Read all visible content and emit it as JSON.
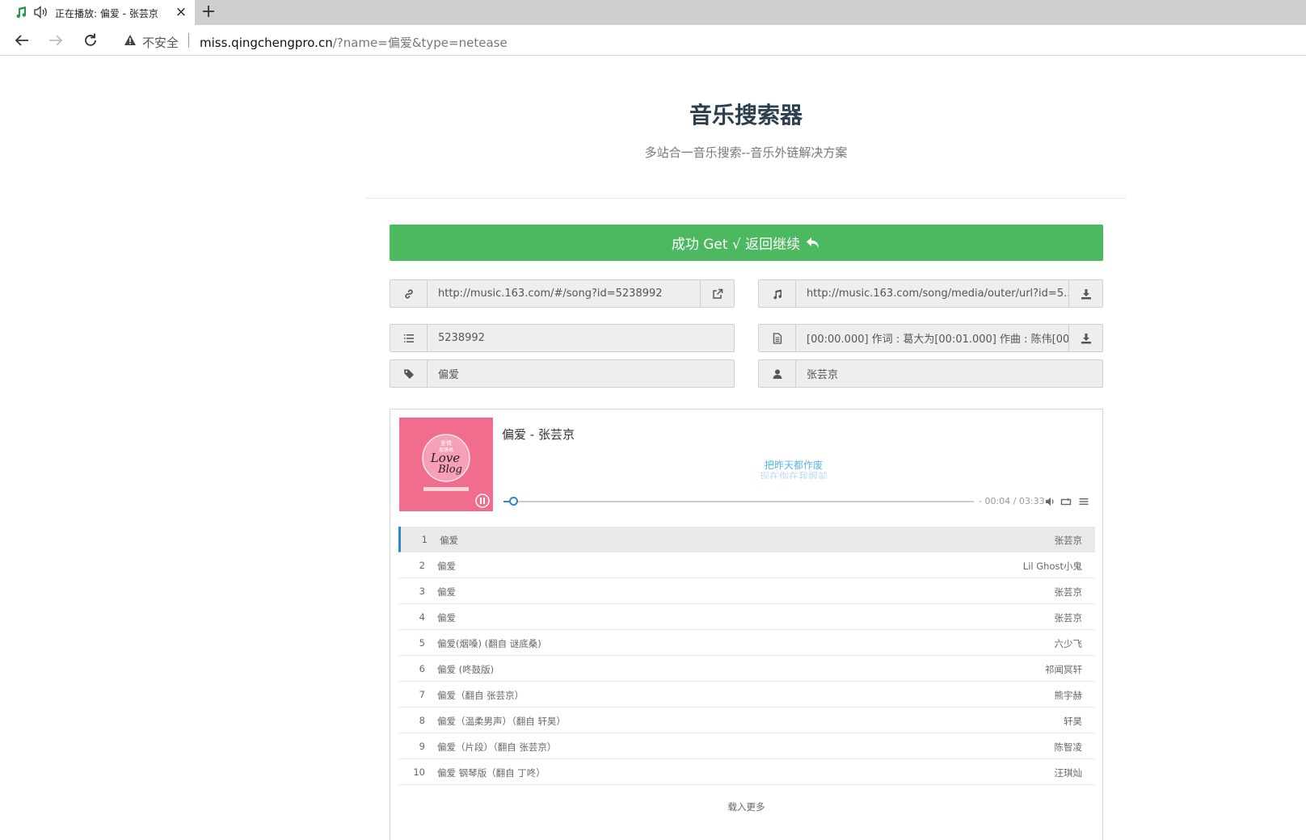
{
  "browser": {
    "tab_title": "正在播放: 偏爱 - 张芸京",
    "new_tab_label": "+",
    "close_label": "×",
    "security_label": "不安全",
    "url_host": "miss.qingchengpro.cn",
    "url_path": "/?name=偏爱&type=netease"
  },
  "header": {
    "title": "音乐搜索器",
    "subtitle": "多站合一音乐搜索--音乐外链解决方案"
  },
  "actions": {
    "success_label": "成功 Get √ 返回继续"
  },
  "fields": {
    "song_link": "http://music.163.com/#/song?id=5238992",
    "media_url": "http://music.163.com/song/media/outer/url?id=5...",
    "song_id": "5238992",
    "lyrics": "[00:00.000] 作词 : 葛大为[00:01.000] 作曲 : 陈伟[00...",
    "song_name": "偏爱",
    "artist": "张芸京"
  },
  "player": {
    "now_playing": "偏爱 - 张芸京",
    "lyric_current": "把昨天都作废",
    "lyric_next": "现在你在我眼前",
    "time": "- 00:04 / 03:33",
    "progress": 0.02,
    "state": "playing"
  },
  "playlist": [
    {
      "num": "1",
      "name": "偏爱",
      "artist": "张芸京"
    },
    {
      "num": "2",
      "name": "偏爱",
      "artist": "Lil Ghost小鬼"
    },
    {
      "num": "3",
      "name": "偏爱",
      "artist": "张芸京"
    },
    {
      "num": "4",
      "name": "偏爱",
      "artist": "张芸京"
    },
    {
      "num": "5",
      "name": "偏爱(烟嗓) (翻自 谜底桑)",
      "artist": "六少飞"
    },
    {
      "num": "6",
      "name": "偏爱 (咚鼓版)",
      "artist": "祁闻冥轩"
    },
    {
      "num": "7",
      "name": "偏爱（翻自 张芸京）",
      "artist": "熊宇赫"
    },
    {
      "num": "8",
      "name": "偏爱（温柔男声）（翻自 轩昊）",
      "artist": "轩昊"
    },
    {
      "num": "9",
      "name": "偏爱（片段）（翻自 张芸京）",
      "artist": "陈智凌"
    },
    {
      "num": "10",
      "name": "偏爱 钢琴版（翻自 丁咚）",
      "artist": "汪琪灿"
    }
  ],
  "load_more_label": "载入更多",
  "colors": {
    "success": "#4cb85f",
    "accent": "#2b88c9",
    "cover": "#f06d8e",
    "title": "#2c3e50"
  },
  "icons": {
    "tab": [
      "music-note-icon",
      "speaker-icon",
      "close-icon"
    ],
    "nav": [
      "back-arrow-icon",
      "forward-arrow-icon",
      "reload-icon",
      "warning-icon"
    ],
    "fields": [
      "link-icon",
      "external-link-icon",
      "music-icon",
      "download-icon",
      "list-ol-icon",
      "file-text-icon",
      "tag-icon",
      "user-icon"
    ],
    "player": [
      "pause-icon",
      "volume-icon",
      "loop-icon",
      "menu-icon",
      "undo-icon"
    ]
  }
}
